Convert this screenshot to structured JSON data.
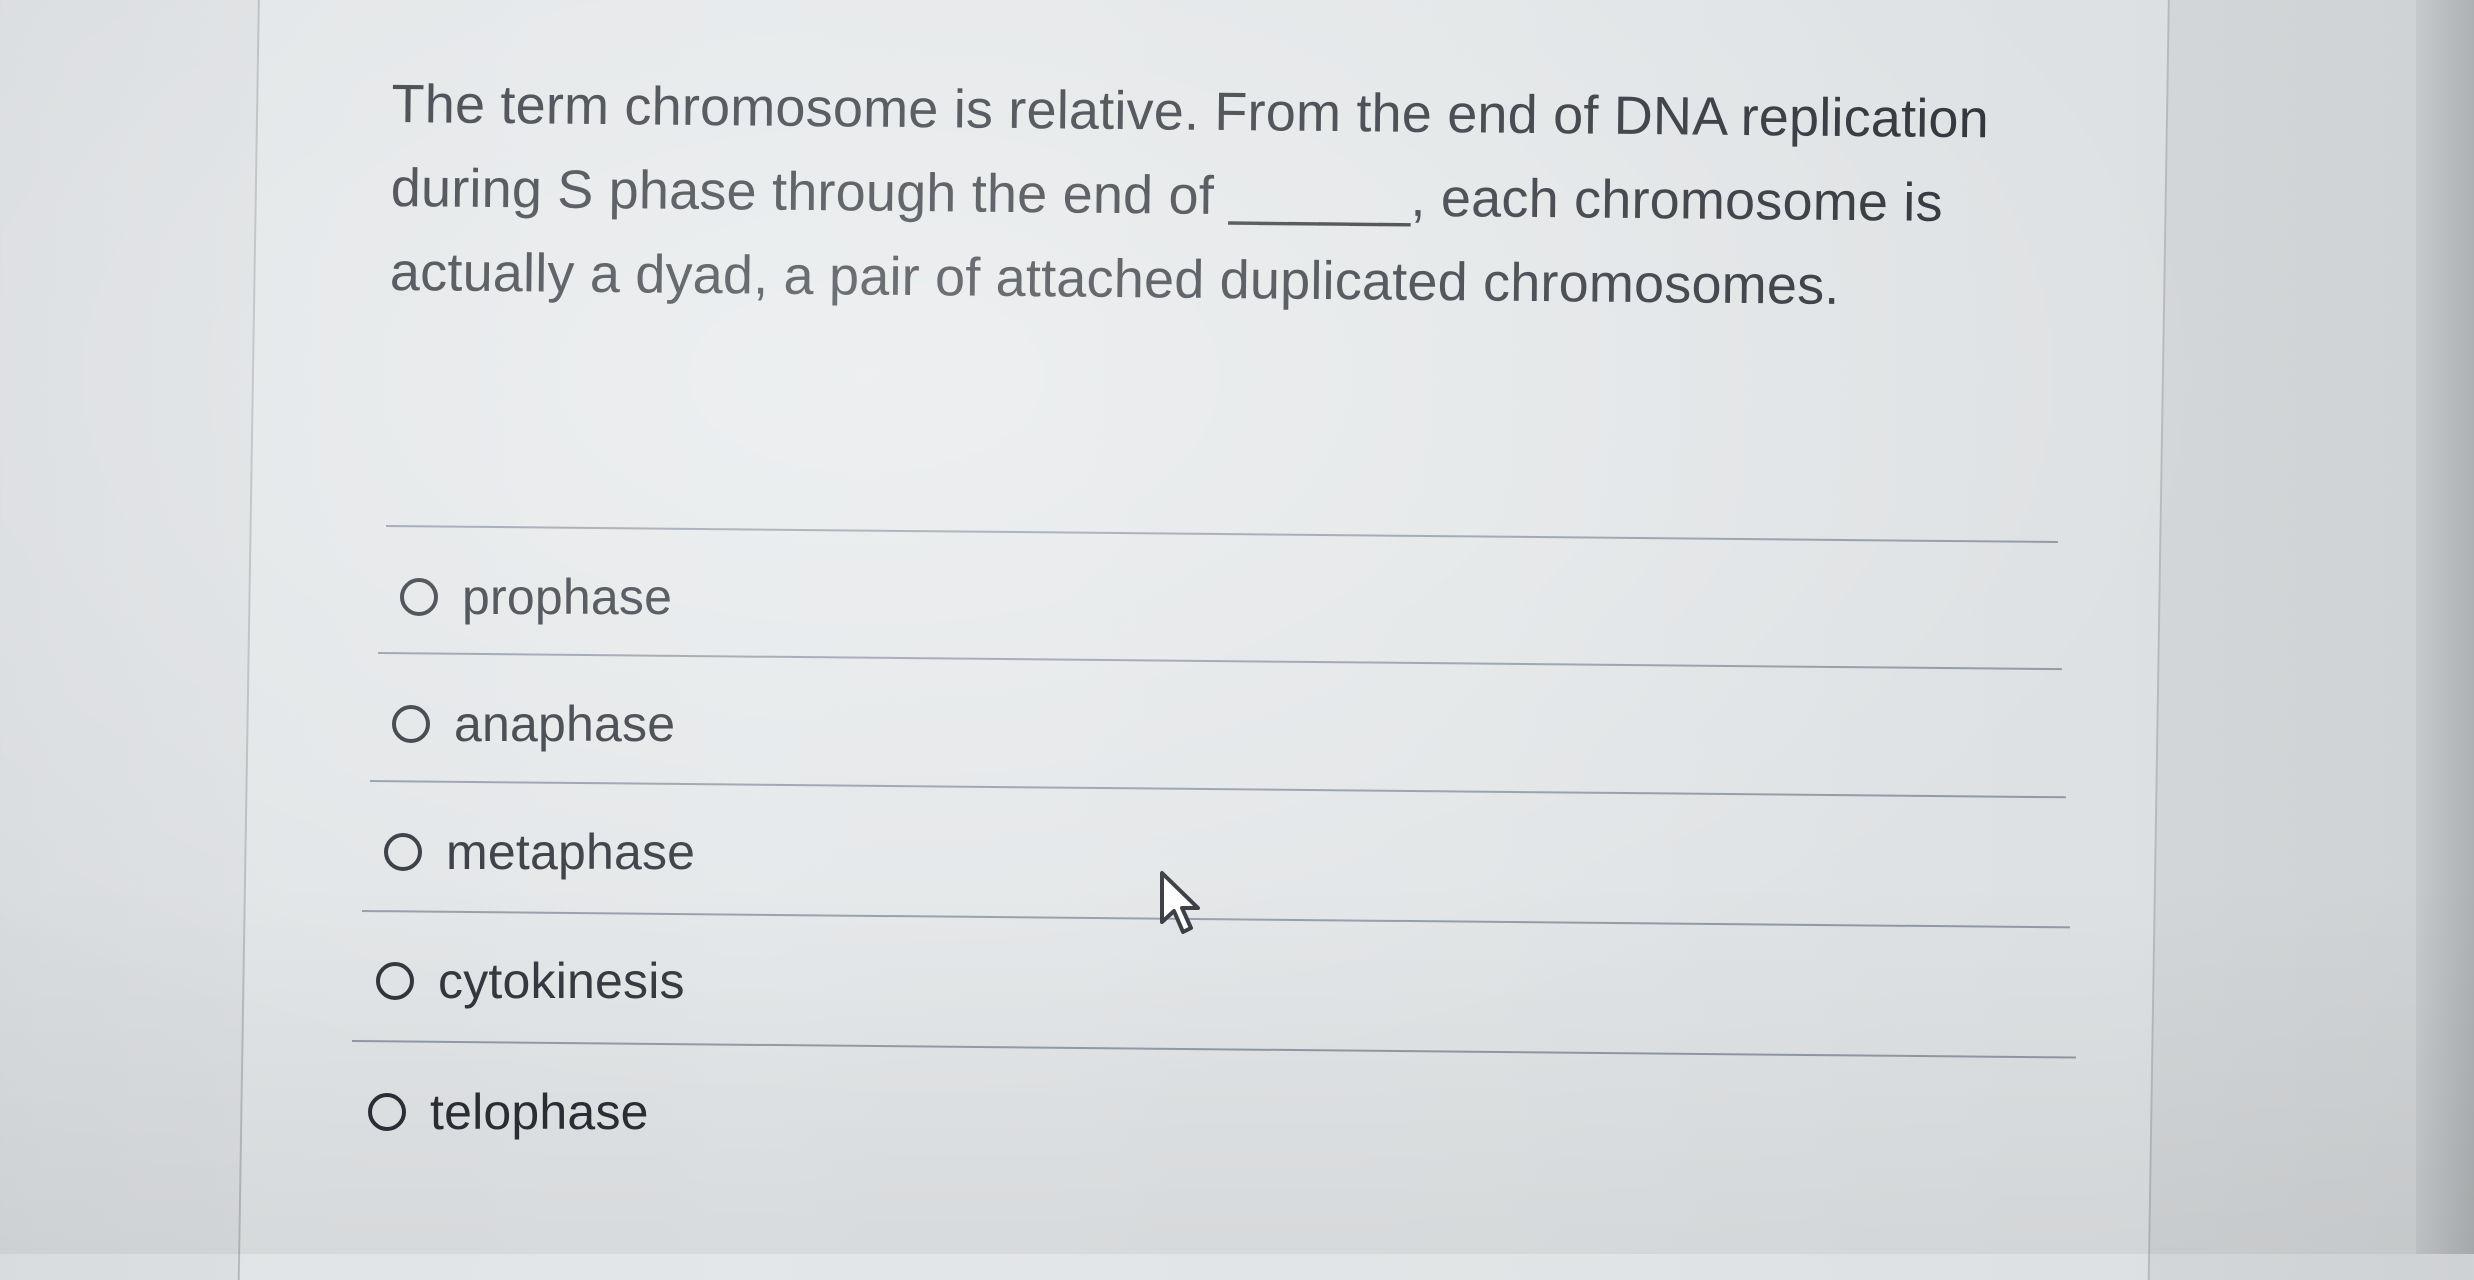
{
  "question": {
    "text": "The term chromosome is relative. From the end of DNA replication during S phase through the end of ______, each chromosome is actually a dyad, a pair of attached duplicated chromosomes."
  },
  "options": [
    {
      "label": "prophase",
      "selected": false
    },
    {
      "label": "anaphase",
      "selected": false
    },
    {
      "label": "metaphase",
      "selected": false
    },
    {
      "label": "cytokinesis",
      "selected": false
    },
    {
      "label": "telophase",
      "selected": false
    }
  ],
  "icons": {
    "radio": "radio-button-icon",
    "cursor": "mouse-pointer-icon"
  }
}
